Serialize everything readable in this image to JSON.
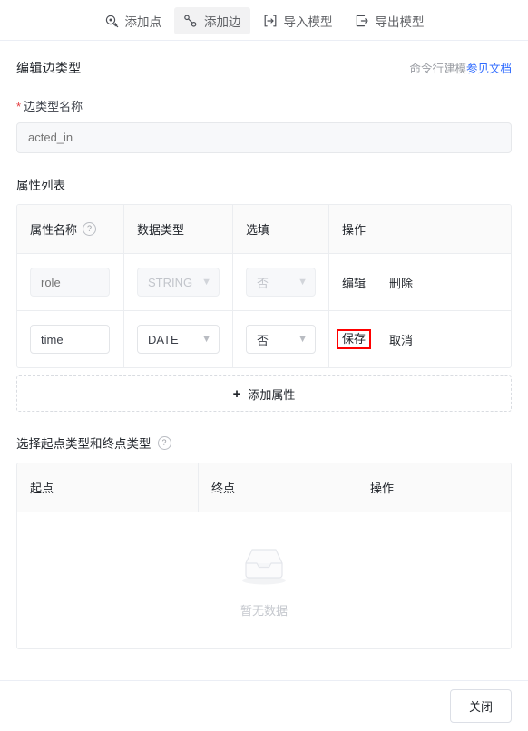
{
  "toolbar": {
    "items": [
      {
        "label": "添加点",
        "icon": "add-point-icon",
        "active": false
      },
      {
        "label": "添加边",
        "icon": "add-edge-icon",
        "active": true
      },
      {
        "label": "导入模型",
        "icon": "import-model-icon",
        "active": false
      },
      {
        "label": "导出模型",
        "icon": "export-model-icon",
        "active": false
      }
    ]
  },
  "header": {
    "title": "编辑边类型",
    "hint_text": "命令行建模",
    "doc_link": "参见文档",
    "link_color": "#2f6bff"
  },
  "edge_name_field": {
    "required_mark": "*",
    "label": "边类型名称",
    "value": "acted_in",
    "placeholder": "acted_in",
    "disabled": true
  },
  "property_section": {
    "title": "属性列表",
    "columns": [
      "属性名称",
      "数据类型",
      "选填",
      "操作"
    ],
    "name_help_icon": "?",
    "rows": [
      {
        "name": "role",
        "type": "STRING",
        "optional": "否",
        "disabled": true,
        "actions": [
          {
            "label": "编辑",
            "highlighted": false
          },
          {
            "label": "删除",
            "highlighted": false
          }
        ]
      },
      {
        "name": "time",
        "type": "DATE",
        "optional": "否",
        "disabled": false,
        "actions": [
          {
            "label": "保存",
            "highlighted": true
          },
          {
            "label": "取消",
            "highlighted": false
          }
        ]
      }
    ],
    "add_button": {
      "icon": "plus-icon",
      "label": "添加属性"
    }
  },
  "endpoint_section": {
    "title": "选择起点类型和终点类型",
    "help_icon": "?",
    "columns": [
      "起点",
      "终点",
      "操作"
    ],
    "empty_text": "暂无数据",
    "empty_icon": "empty-box-icon"
  },
  "footer": {
    "close_label": "关闭"
  },
  "annotation": {
    "box_color": "#ff0000",
    "target": "保存"
  }
}
